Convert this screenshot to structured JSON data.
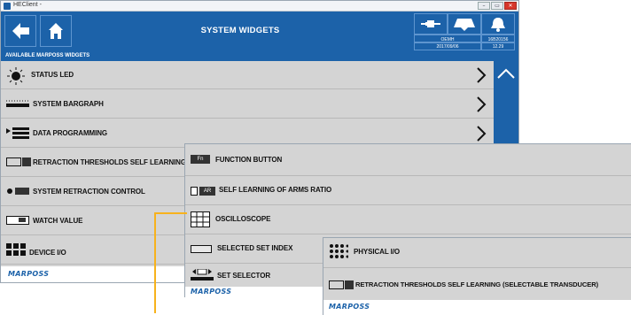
{
  "window": {
    "title": "HEClient -",
    "controls": [
      "minimize-button",
      "maximize-button",
      "close-button"
    ]
  },
  "header": {
    "title": "SYSTEM WIDGETS",
    "status": {
      "label": "OEMH",
      "date": "2017/09/06",
      "code": "16B20156",
      "time": "12.29"
    }
  },
  "section": {
    "label": "AVAILABLE MARPOSS WIDGETS"
  },
  "main_rows": [
    {
      "label": "STATUS LED",
      "icon": "status-led-icon"
    },
    {
      "label": "SYSTEM BARGRAPH",
      "icon": "bargraph-icon"
    },
    {
      "label": "DATA PROGRAMMING",
      "icon": "data-programming-icon"
    },
    {
      "label": "RETRACTION THRESHOLDS SELF LEARNING",
      "icon": "retraction-icon"
    },
    {
      "label": "SYSTEM RETRACTION CONTROL",
      "icon": "retraction-control-icon"
    },
    {
      "label": "WATCH VALUE",
      "icon": "watch-value-icon"
    },
    {
      "label": "DEVICE I/O",
      "icon": "device-io-icon"
    }
  ],
  "win2_rows": [
    {
      "label": "FUNCTION BUTTON",
      "icon": "function-button-icon",
      "icon_text": "Fn"
    },
    {
      "label": "SELF LEARNING OF ARMS RATIO",
      "icon": "arms-ratio-icon",
      "icon_text": "AR"
    },
    {
      "label": "OSCILLOSCOPE",
      "icon": "oscilloscope-icon"
    },
    {
      "label": "SELECTED SET INDEX",
      "icon": "set-index-icon"
    },
    {
      "label": "SET SELECTOR",
      "icon": "set-selector-icon"
    }
  ],
  "win3_rows": [
    {
      "label": "PHYSICAL I/O",
      "icon": "physical-io-icon"
    },
    {
      "label": "RETRACTION THRESHOLDS SELF LEARNING (SELECTABLE TRANSDUCER)",
      "icon": "retraction-transducer-icon"
    }
  ],
  "brand": "MARPOSS",
  "colors": {
    "header": "#1c62a9",
    "row_bg": "#d4d4d4",
    "connector": "#f7b21c",
    "text": "#111111"
  }
}
